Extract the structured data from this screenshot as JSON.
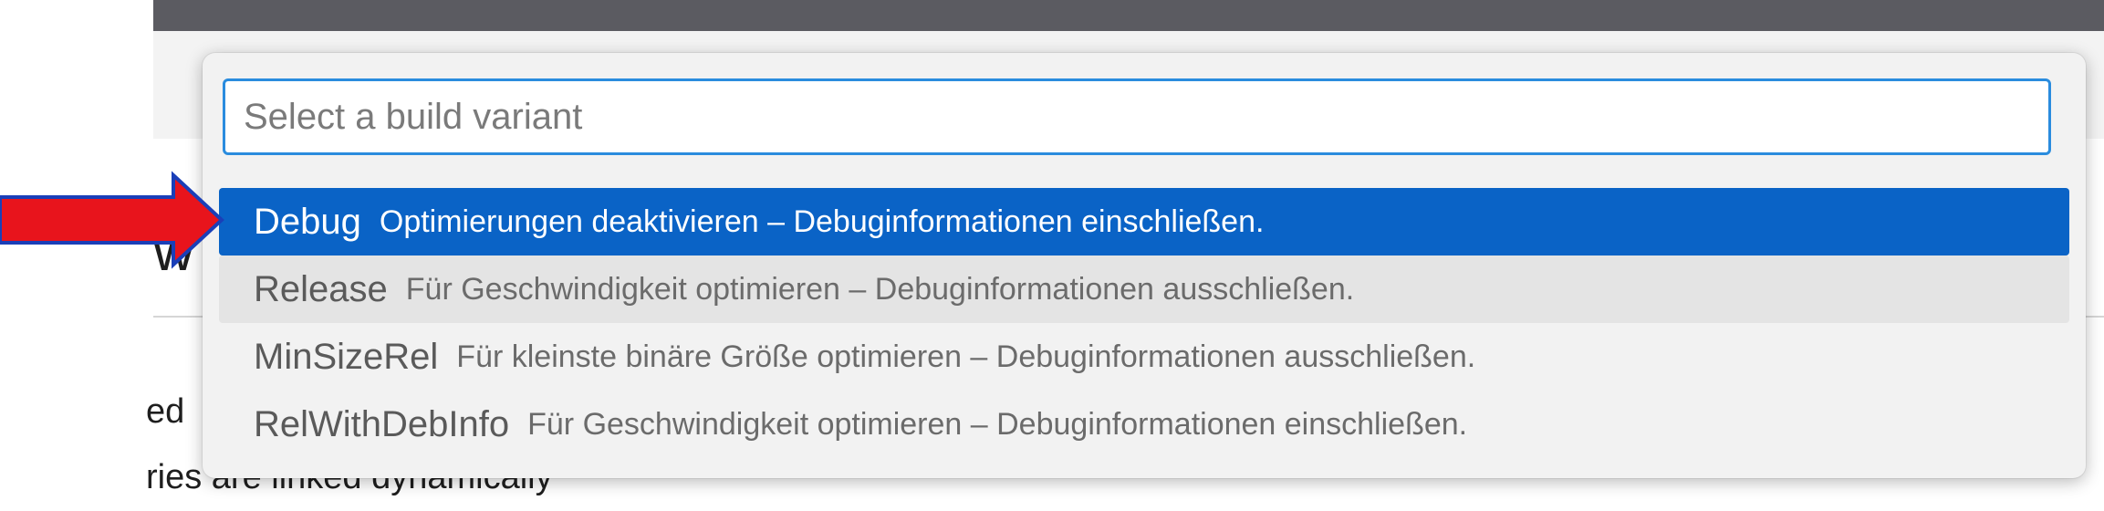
{
  "background": {
    "heading_fragment": "w",
    "lines": [
      "ed",
      "ries are linked dynamically"
    ]
  },
  "quick_pick": {
    "input": {
      "value": "",
      "placeholder": "Select a build variant"
    },
    "items": [
      {
        "label": "Debug",
        "description": "Optimierungen deaktivieren – Debuginformationen einschließen.",
        "state": "selected"
      },
      {
        "label": "Release",
        "description": "Für Geschwindigkeit optimieren – Debuginformationen ausschließen.",
        "state": "hovered"
      },
      {
        "label": "MinSizeRel",
        "description": "Für kleinste binäre Größe optimieren – Debuginformationen ausschließen.",
        "state": "normal"
      },
      {
        "label": "RelWithDebInfo",
        "description": "Für Geschwindigkeit optimieren – Debuginformationen einschließen.",
        "state": "normal"
      }
    ]
  },
  "annotation": {
    "icon": "red-arrow-icon",
    "fill_color": "#e8141c",
    "outline_color": "#1a3fb8"
  },
  "colors": {
    "accent": "#0a63c6",
    "input_border": "#2a8cde",
    "hover": "#e4e4e4",
    "top_bar": "#5b5b61"
  }
}
